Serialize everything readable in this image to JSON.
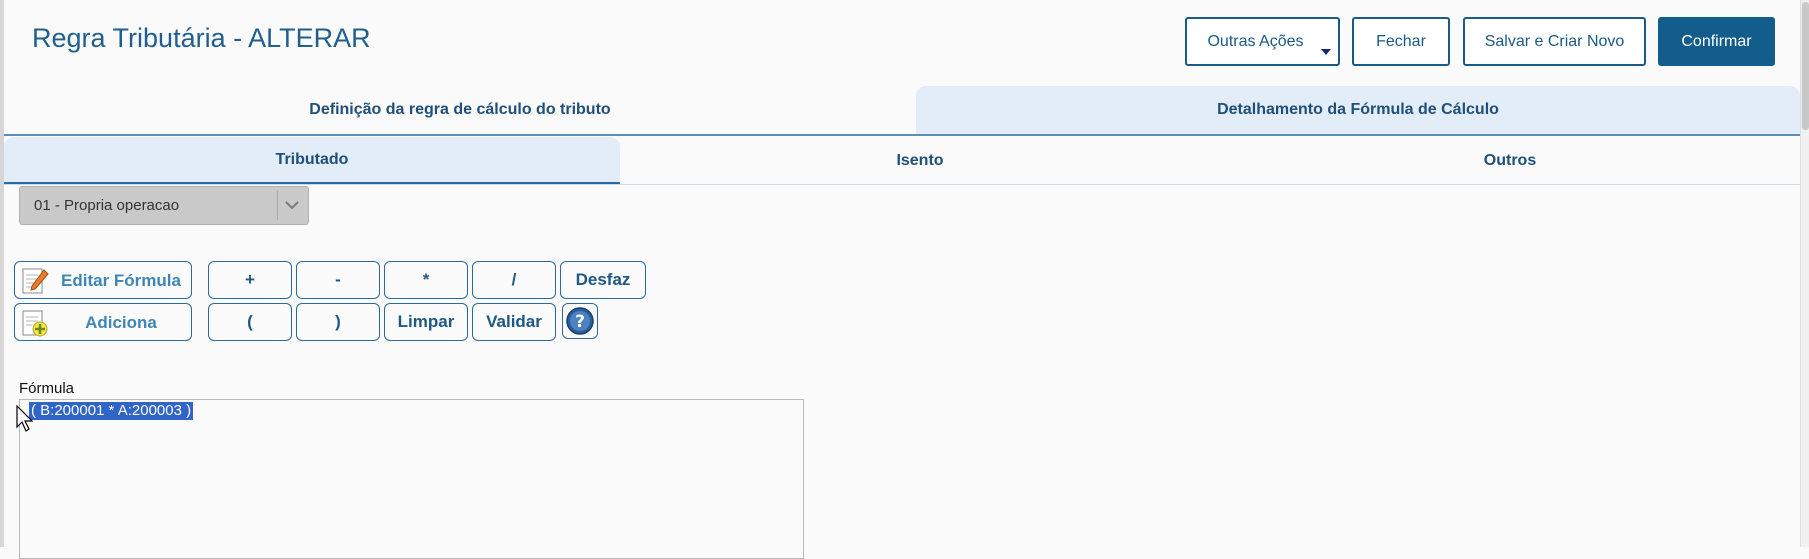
{
  "title": "Regra Tributária - ALTERAR",
  "header_buttons": {
    "outras_acoes": "Outras Ações",
    "fechar": "Fechar",
    "salvar_criar_novo": "Salvar e Criar Novo",
    "confirmar": "Confirmar"
  },
  "main_tabs": [
    {
      "label": "Definição da regra de cálculo do tributo",
      "active": false
    },
    {
      "label": "Detalhamento da Fórmula de Cálculo",
      "active": true
    }
  ],
  "sub_tabs": [
    {
      "label": "Tributado",
      "active": true
    },
    {
      "label": "Isento",
      "active": false
    },
    {
      "label": "Outros",
      "active": false
    }
  ],
  "operation_select": {
    "value": "01 - Propria operacao"
  },
  "action_buttons": {
    "editar_formula": "Editar Fórmula",
    "adiciona": "Adiciona"
  },
  "operator_buttons": {
    "row1": [
      "+",
      "-",
      "*",
      "/",
      "Desfaz"
    ],
    "row2": [
      "(",
      ")",
      "Limpar",
      "Validar"
    ]
  },
  "formula": {
    "label": "Fórmula",
    "value": "( B:200001 * A:200003 )"
  },
  "colors": {
    "accent": "#135d8c",
    "tab_active_bg": "#e3edf7",
    "selection": "#2f64c8"
  }
}
